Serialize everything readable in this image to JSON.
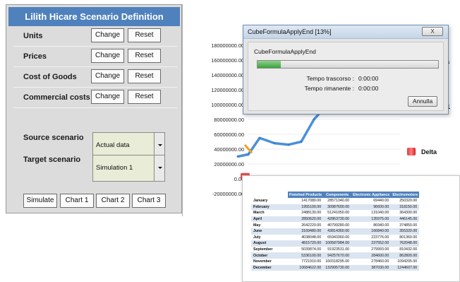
{
  "panel": {
    "title": "Lilith Hicare Scenario Definition",
    "rows": [
      {
        "label": "Units",
        "change": "Change",
        "reset": "Reset"
      },
      {
        "label": "Prices",
        "change": "Change",
        "reset": "Reset"
      },
      {
        "label": "Cost of Goods",
        "change": "Change",
        "reset": "Reset"
      },
      {
        "label": "Commercial costs",
        "change": "Change",
        "reset": "Reset"
      }
    ],
    "source_label": "Source scenario",
    "target_label": "Target scenario",
    "source_value": "Actual data",
    "target_value": "Simulation 1",
    "buttons": {
      "simulate": "Simulate",
      "chart1": "Chart 1",
      "chart2": "Chart 2",
      "chart3": "Chart 3"
    }
  },
  "chart": {
    "yticks": [
      "180000000.00",
      "160000000.00",
      "140000000.00",
      "120000000.00",
      "100000000.00",
      "80000000.00",
      "60000000.00",
      "40000000.00",
      "20000000.00",
      "0.00",
      "-20000000.00"
    ],
    "legend_partial_a": "a",
    "legend_partial_1": "1",
    "legend_delta": "Delta"
  },
  "chart_data": {
    "type": "line",
    "ylim": [
      -20000000,
      180000000
    ],
    "series": [
      {
        "values": [
          30000000,
          33000000,
          55000000,
          48000000,
          46000000,
          50000000,
          80000000,
          100000000
        ]
      }
    ],
    "delta_marker": [
      5000000
    ]
  },
  "dialog": {
    "title": "CubeFormulaApplyEnd [13%]",
    "close": "X",
    "message": "CubeFormulaApplyEnd",
    "progress_pct": 0.13,
    "elapsed_label": "Tempo trascorso :",
    "elapsed_value": "0:00:00",
    "remaining_label": "Tempo rimanente :",
    "remaining_value": "0:00:00",
    "cancel": "Annulla"
  },
  "table": {
    "columns": [
      "",
      "Finished Products",
      "Components",
      "Electronic Appliance",
      "Electromotors"
    ],
    "rows": [
      [
        "January",
        "1417080.00",
        "28571340.00",
        "69440.00",
        "250320.00"
      ],
      [
        "February",
        "1955100.00",
        "30987600.00",
        "96600.00",
        "318150.00"
      ],
      [
        "March",
        "2488130.00",
        "51241050.00",
        "131040.00",
        "364300.00"
      ],
      [
        "April",
        "2850620.00",
        "42863730.00",
        "135975.00",
        "446145.00"
      ],
      [
        "May",
        "2642220.00",
        "40799280.00",
        "86940.00",
        "374850.00"
      ],
      [
        "June",
        "3169480.00",
        "43814360.00",
        "166840.00",
        "355320.00"
      ],
      [
        "July",
        "4038048.00",
        "65943360.00",
        "223776.00",
        "801360.00"
      ],
      [
        "August",
        "4815720.00",
        "100587984.00",
        "237552.00",
        "762048.00"
      ],
      [
        "September",
        "5039874.00",
        "91923531.00",
        "279993.00",
        "810432.00"
      ],
      [
        "October",
        "5336100.00",
        "94257670.00",
        "284600.00",
        "862800.00"
      ],
      [
        "November",
        "7721910.00",
        "160318295.00",
        "278460.00",
        "1094205.00"
      ],
      [
        "December",
        "10684622.00",
        "132995730.00",
        "387030.00",
        "1244607.00"
      ]
    ]
  }
}
